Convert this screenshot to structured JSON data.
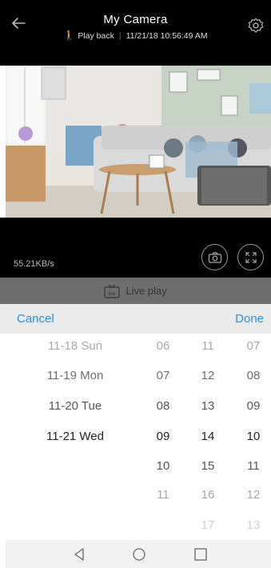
{
  "header": {
    "title": "My Camera",
    "playback_label": "Play back",
    "timestamp": "11/21/18 10:56:49 AM"
  },
  "video": {
    "speed": "55.21KB/s"
  },
  "live_bar": {
    "label": "Live play",
    "icon_text": "live"
  },
  "picker": {
    "cancel_label": "Cancel",
    "done_label": "Done",
    "dates": [
      "11-18 Sun",
      "11-19 Mon",
      "11-20 Tue",
      "11-21 Wed"
    ],
    "col2": [
      "06",
      "07",
      "08",
      "09",
      "10",
      "11"
    ],
    "col3": [
      "11",
      "12",
      "13",
      "14",
      "15",
      "16",
      "17"
    ],
    "col4": [
      "07",
      "08",
      "09",
      "10",
      "11",
      "12",
      "13"
    ]
  },
  "colors": {
    "accent": "#2e8fd8",
    "header_bg": "#000000",
    "live_bar_bg": "#6e6e6e",
    "playback_icon": "#f0a324"
  },
  "icons": [
    "back-arrow-icon",
    "gear-icon",
    "walking-person-icon",
    "camera-icon",
    "fullscreen-icon",
    "tv-icon",
    "nav-back-icon",
    "nav-home-icon",
    "nav-recents-icon"
  ]
}
